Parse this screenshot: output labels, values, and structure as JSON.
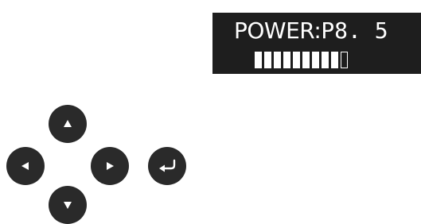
{
  "display": {
    "label": "POWER:",
    "value": "P8. 5",
    "bar": {
      "segments_total": 10,
      "segments_filled": 9
    }
  },
  "controls": {
    "up": "up-arrow-icon",
    "left": "left-arrow-icon",
    "right": "right-arrow-icon",
    "down": "down-arrow-icon",
    "enter": "enter-return-icon"
  },
  "colors": {
    "display_background": "#1e1e1e",
    "display_text": "#ffffff",
    "button_fill": "#2a2a2a",
    "icon": "#ffffff"
  }
}
